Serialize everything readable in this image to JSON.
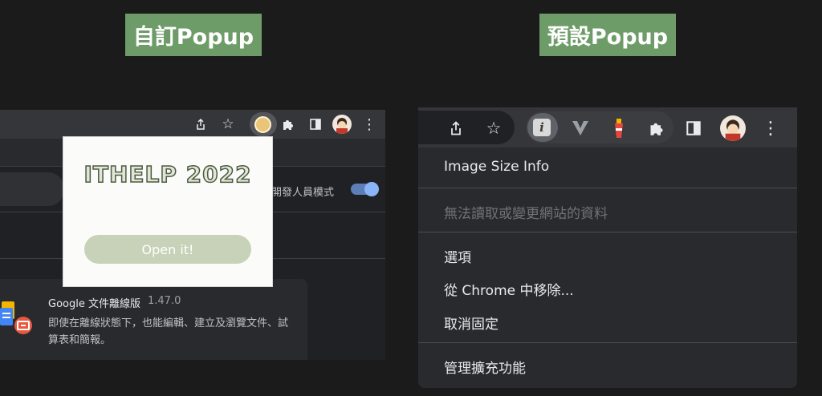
{
  "labels": {
    "custom_popup": "自訂Popup",
    "default_popup": "預設Popup"
  },
  "left": {
    "toolbar_icons": [
      "share-icon",
      "star-icon",
      "extension-smile-icon",
      "puzzle-icon",
      "side-panel-icon",
      "avatar",
      "menu-kebab-icon"
    ],
    "developer_mode_label": "開發人員模式",
    "developer_mode_on": true,
    "extension_card": {
      "name": "Google 文件離線版",
      "version": "1.47.0",
      "description": "即使在離線狀態下，也能編輯、建立及瀏覽文件、試算表和簡報。"
    },
    "popup": {
      "title": "ITHELP 2022",
      "button_label": "Open it!"
    }
  },
  "right": {
    "toolbar_icons": [
      "share-icon",
      "star-icon",
      "info-extension-icon",
      "v-extension-icon",
      "lighthouse-icon",
      "puzzle-icon",
      "side-panel-icon",
      "avatar",
      "menu-kebab-icon"
    ],
    "menu": {
      "extension_name": "Image Size Info",
      "cannot_access": "無法讀取或變更網站的資料",
      "options": "選項",
      "remove": "從 Chrome 中移除...",
      "unpin": "取消固定",
      "manage": "管理擴充功能"
    }
  },
  "colors": {
    "label_green": "#6e9c68",
    "popup_button": "#c7d2b8",
    "toggle_blue": "#8ab4f8"
  }
}
